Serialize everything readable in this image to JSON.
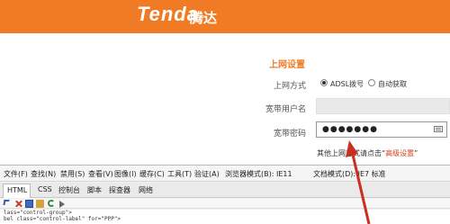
{
  "brand": {
    "logo": "Tenda",
    "name_cn": "腾达",
    "bar_color": "#f07b24"
  },
  "settings": {
    "title": "上网设置",
    "mode_label": "上网方式",
    "mode_options": [
      {
        "label": "ADSL拨号",
        "selected": true
      },
      {
        "label": "自动获取",
        "selected": false
      }
    ],
    "username_label": "宽带用户名",
    "username_value": "",
    "password_label": "宽带密码",
    "password_value": "●●●●●●●",
    "hint_prefix": "其他上网方式请点击“",
    "hint_link": "高级设置",
    "hint_suffix": "”",
    "accent_color": "#d43d1a"
  },
  "devtools": {
    "menu": [
      "文件(F)",
      "查找(N)",
      "禁用(S)",
      "查看(V)",
      "图像(I)",
      "缓存(C)",
      "工具(T)",
      "验证(A)",
      "浏览器模式(B): IE11",
      "文档模式(D): IE7 标准"
    ],
    "tabs": [
      "HTML",
      "CSS",
      "控制台",
      "脚本",
      "探查器",
      "网络"
    ],
    "source_lines": [
      "lass=\"control-group\">",
      "bel class=\"control-label\" for=\"PPP\">"
    ]
  }
}
